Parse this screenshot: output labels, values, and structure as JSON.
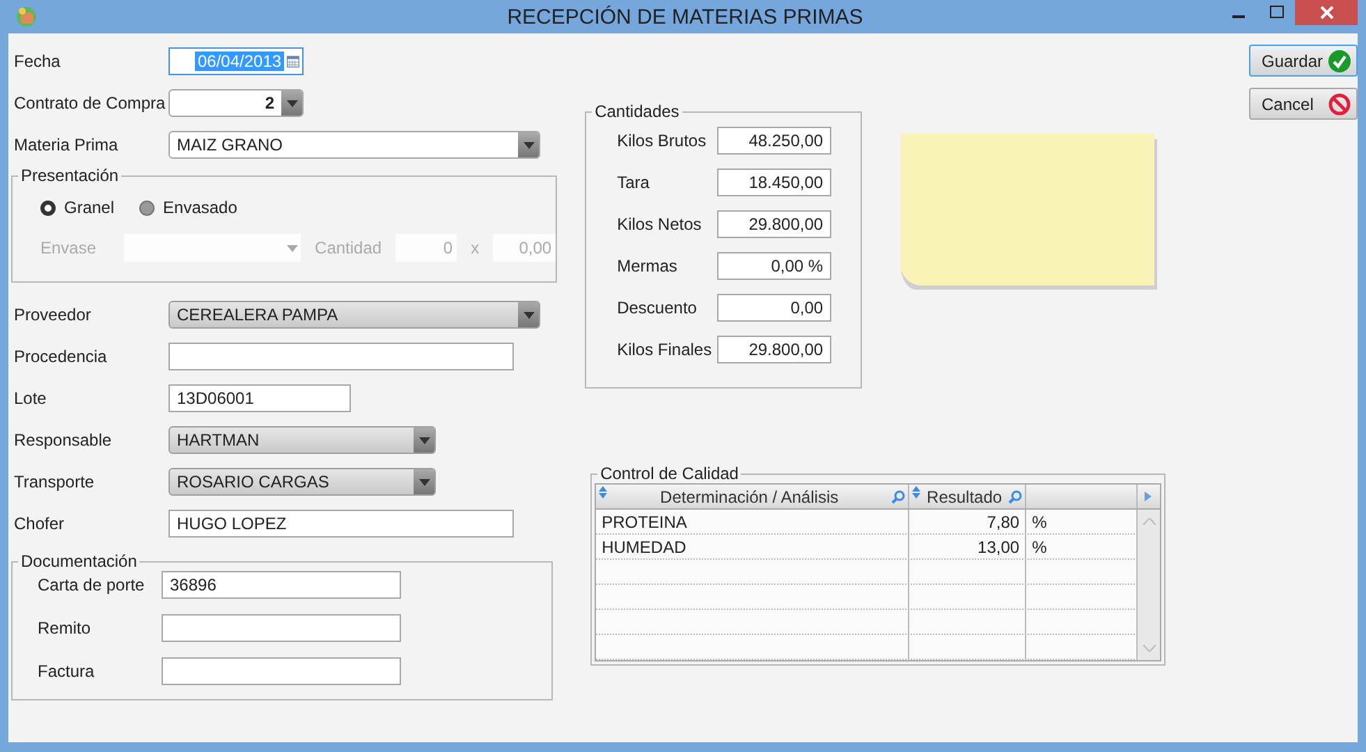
{
  "window": {
    "title": "RECEPCIÓN DE MATERIAS PRIMAS"
  },
  "header_fields": [
    {
      "kind": "date",
      "label": "Fecha",
      "value": "06/04/2013",
      "focused": true
    },
    {
      "kind": "spin-combo",
      "label": "Contrato de Compra",
      "value": "2",
      "focused": false
    },
    {
      "kind": "combo",
      "label": "Materia Prima",
      "value": "MAIZ GRANO",
      "focused": false
    }
  ],
  "presentation": {
    "title": "Presentación",
    "options": [
      {
        "label": "Granel",
        "selected": true
      },
      {
        "label": "Envasado",
        "selected": false
      }
    ],
    "disabled": true,
    "envase_label": "Envase",
    "cantidad_label": "Cantidad",
    "cantidad": "0",
    "times": "x",
    "unit_value": "0,00"
  },
  "fields": [
    {
      "kind": "list-combo",
      "label": "Proveedor",
      "value": "CEREALERA PAMPA"
    },
    {
      "kind": "text",
      "label": "Procedencia"
    },
    {
      "kind": "text",
      "label": "Lote",
      "value": "13D06001"
    },
    {
      "kind": "list-combo",
      "label": "Responsable",
      "value": "HARTMAN"
    },
    {
      "kind": "list-combo",
      "label": "Transporte",
      "value": "ROSARIO CARGAS"
    },
    {
      "kind": "text",
      "label": "Chofer",
      "value": "HUGO LOPEZ"
    }
  ],
  "documentation": {
    "title": "Documentación",
    "fields": [
      {
        "label": "Carta de porte",
        "value": "36896"
      },
      {
        "label": "Remito"
      },
      {
        "label": "Factura"
      }
    ]
  },
  "quantities": {
    "title": "Cantidades",
    "rows": [
      {
        "label": "Kilos Brutos",
        "value": "48.250,00"
      },
      {
        "label": "Tara",
        "value": "18.450,00"
      },
      {
        "label": "Kilos Netos",
        "value": "29.800,00"
      },
      {
        "label": "Mermas",
        "value": "0,00 %"
      },
      {
        "label": "Descuento",
        "value": "0,00"
      },
      {
        "label": "Kilos Finales",
        "value": "29.800,00"
      }
    ]
  },
  "quality": {
    "title": "Control de Calidad",
    "columns": [
      "Determinación / Análisis",
      "Resultado"
    ],
    "rows": [
      {
        "name": "PROTEINA",
        "result": "7,80",
        "unit": "%"
      },
      {
        "name": "HUMEDAD",
        "result": "13,00",
        "unit": "%"
      }
    ]
  },
  "buttons": [
    {
      "label": "Guardar",
      "kind": "confirm",
      "focused": true
    },
    {
      "label": "Cancel",
      "kind": "cancel",
      "focused": false
    }
  ]
}
